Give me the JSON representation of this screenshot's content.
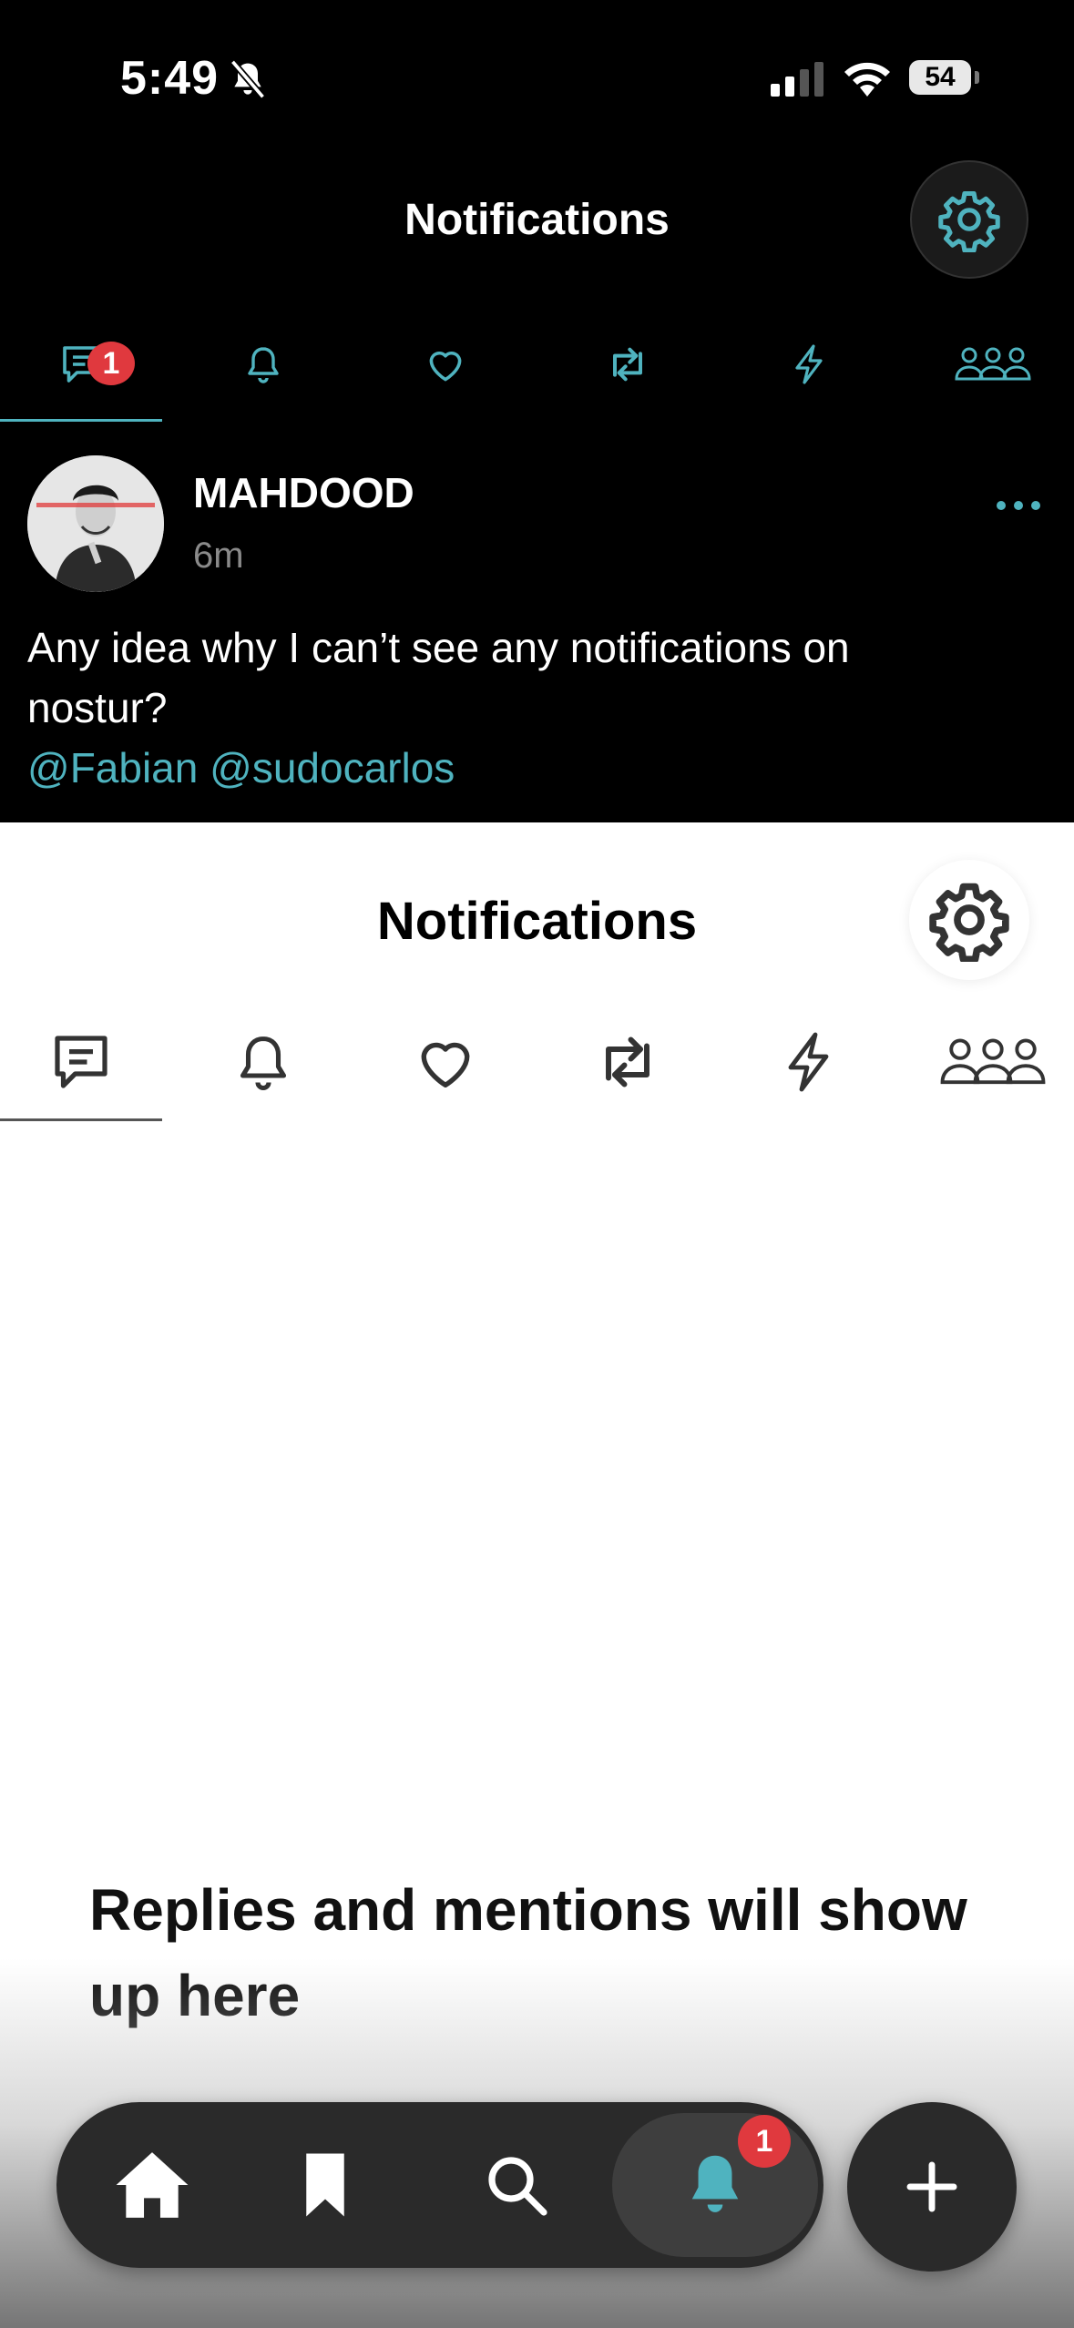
{
  "status_bar": {
    "time": "5:49",
    "battery": "54"
  },
  "overlay": {
    "header": {
      "title": "Notifications"
    },
    "tabs": [
      {
        "icon": "chat-bubble-icon",
        "badge": "1",
        "active": true
      },
      {
        "icon": "bell-icon"
      },
      {
        "icon": "heart-icon"
      },
      {
        "icon": "repost-icon"
      },
      {
        "icon": "lightning-icon"
      },
      {
        "icon": "people-icon"
      }
    ],
    "post": {
      "author": "MAHDOOD",
      "time_ago": "6m",
      "text": "Any idea why I can’t see any notifications on nostur?",
      "mentions": "@Fabian @sudocarlos"
    }
  },
  "main": {
    "header": {
      "title": "Notifications"
    },
    "tabs": [
      {
        "icon": "chat-bubble-icon",
        "active": true
      },
      {
        "icon": "bell-icon"
      },
      {
        "icon": "heart-icon"
      },
      {
        "icon": "repost-icon"
      },
      {
        "icon": "lightning-icon"
      },
      {
        "icon": "people-icon"
      }
    ],
    "empty_state": "Replies and mentions will show up here"
  },
  "bottom_nav": {
    "items": [
      {
        "icon": "home-icon"
      },
      {
        "icon": "bookmark-icon"
      },
      {
        "icon": "search-icon"
      },
      {
        "icon": "bell-icon",
        "badge": "1",
        "active": true
      }
    ],
    "fab_icon": "plus-icon"
  },
  "colors": {
    "accent": "#4fb3bf",
    "badge": "#e0393e",
    "dark_bg": "#000000",
    "nav_bg": "#2a2a2a"
  }
}
